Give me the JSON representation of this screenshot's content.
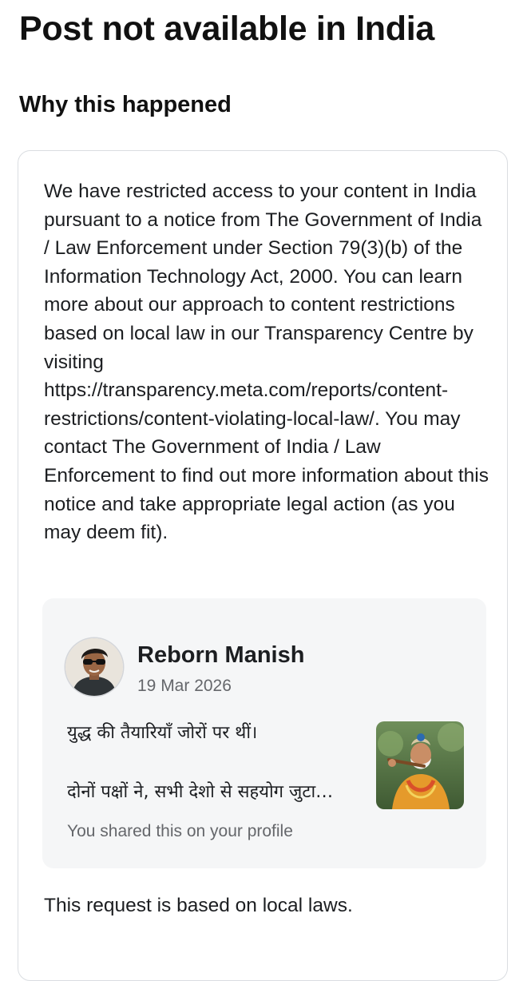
{
  "page": {
    "title": "Post not available in India"
  },
  "reason": {
    "heading": "Why this happened",
    "notice_text": "We have restricted access to your content in India pursuant to a notice from The Government of India / Law Enforcement under Section 79(3)(b) of the Information Technology Act, 2000. You can learn more about our approach to content restrictions based on local law in our Transparency Centre by visiting https://transparency.meta.com/reports/content-restrictions/content-violating-local-law/. You may contact The Government of India / Law Enforcement to find out more information about this notice and take appropriate legal action (as you may deem fit).",
    "footer_text": "This request is based on local laws."
  },
  "post": {
    "author_name": "Reborn Manish",
    "date": "19 Mar 2026",
    "text_line_1": "युद्ध की तैयारियाँ जोरों पर थीं।",
    "text_line_2": "दोनों पक्षों ने, सभी देशो से सहयोग जुटा…",
    "shared_note": "You shared this on your profile",
    "avatar_icon": "profile-photo-avatar",
    "thumbnail_icon": "post-image-thumbnail"
  },
  "colors": {
    "text_primary": "#1c1e21",
    "text_secondary": "#65676b",
    "card_border": "#dadde1",
    "post_background": "#f5f6f7"
  }
}
